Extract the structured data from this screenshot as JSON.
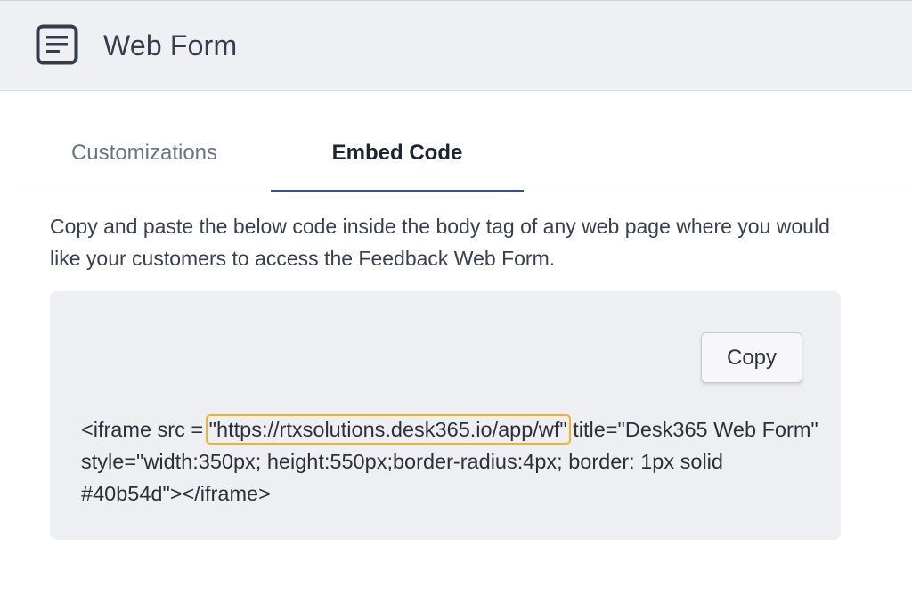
{
  "header": {
    "title": "Web Form",
    "icon": "document-lines-icon"
  },
  "tabs": [
    {
      "label": "Customizations",
      "active": false
    },
    {
      "label": "Embed Code",
      "active": true
    }
  ],
  "description": "Copy and paste the below code inside the body tag of any web page where you would like your customers to access the Feedback Web Form.",
  "embed": {
    "copy_label": "Copy",
    "code_prefix": "<iframe src = ",
    "code_url": "\"https://rtxsolutions.desk365.io/app/wf\"",
    "code_suffix": " title=\"Desk365 Web Form\" style=\"width:350px; height:550px;border-radius:4px; border: 1px solid #40b54d\"></iframe>"
  },
  "colors": {
    "header_bg": "#eef0f4",
    "active_tab_underline": "#3a4ca0",
    "url_highlight": "#f0b429",
    "panel_bg": "#eeeff2"
  }
}
